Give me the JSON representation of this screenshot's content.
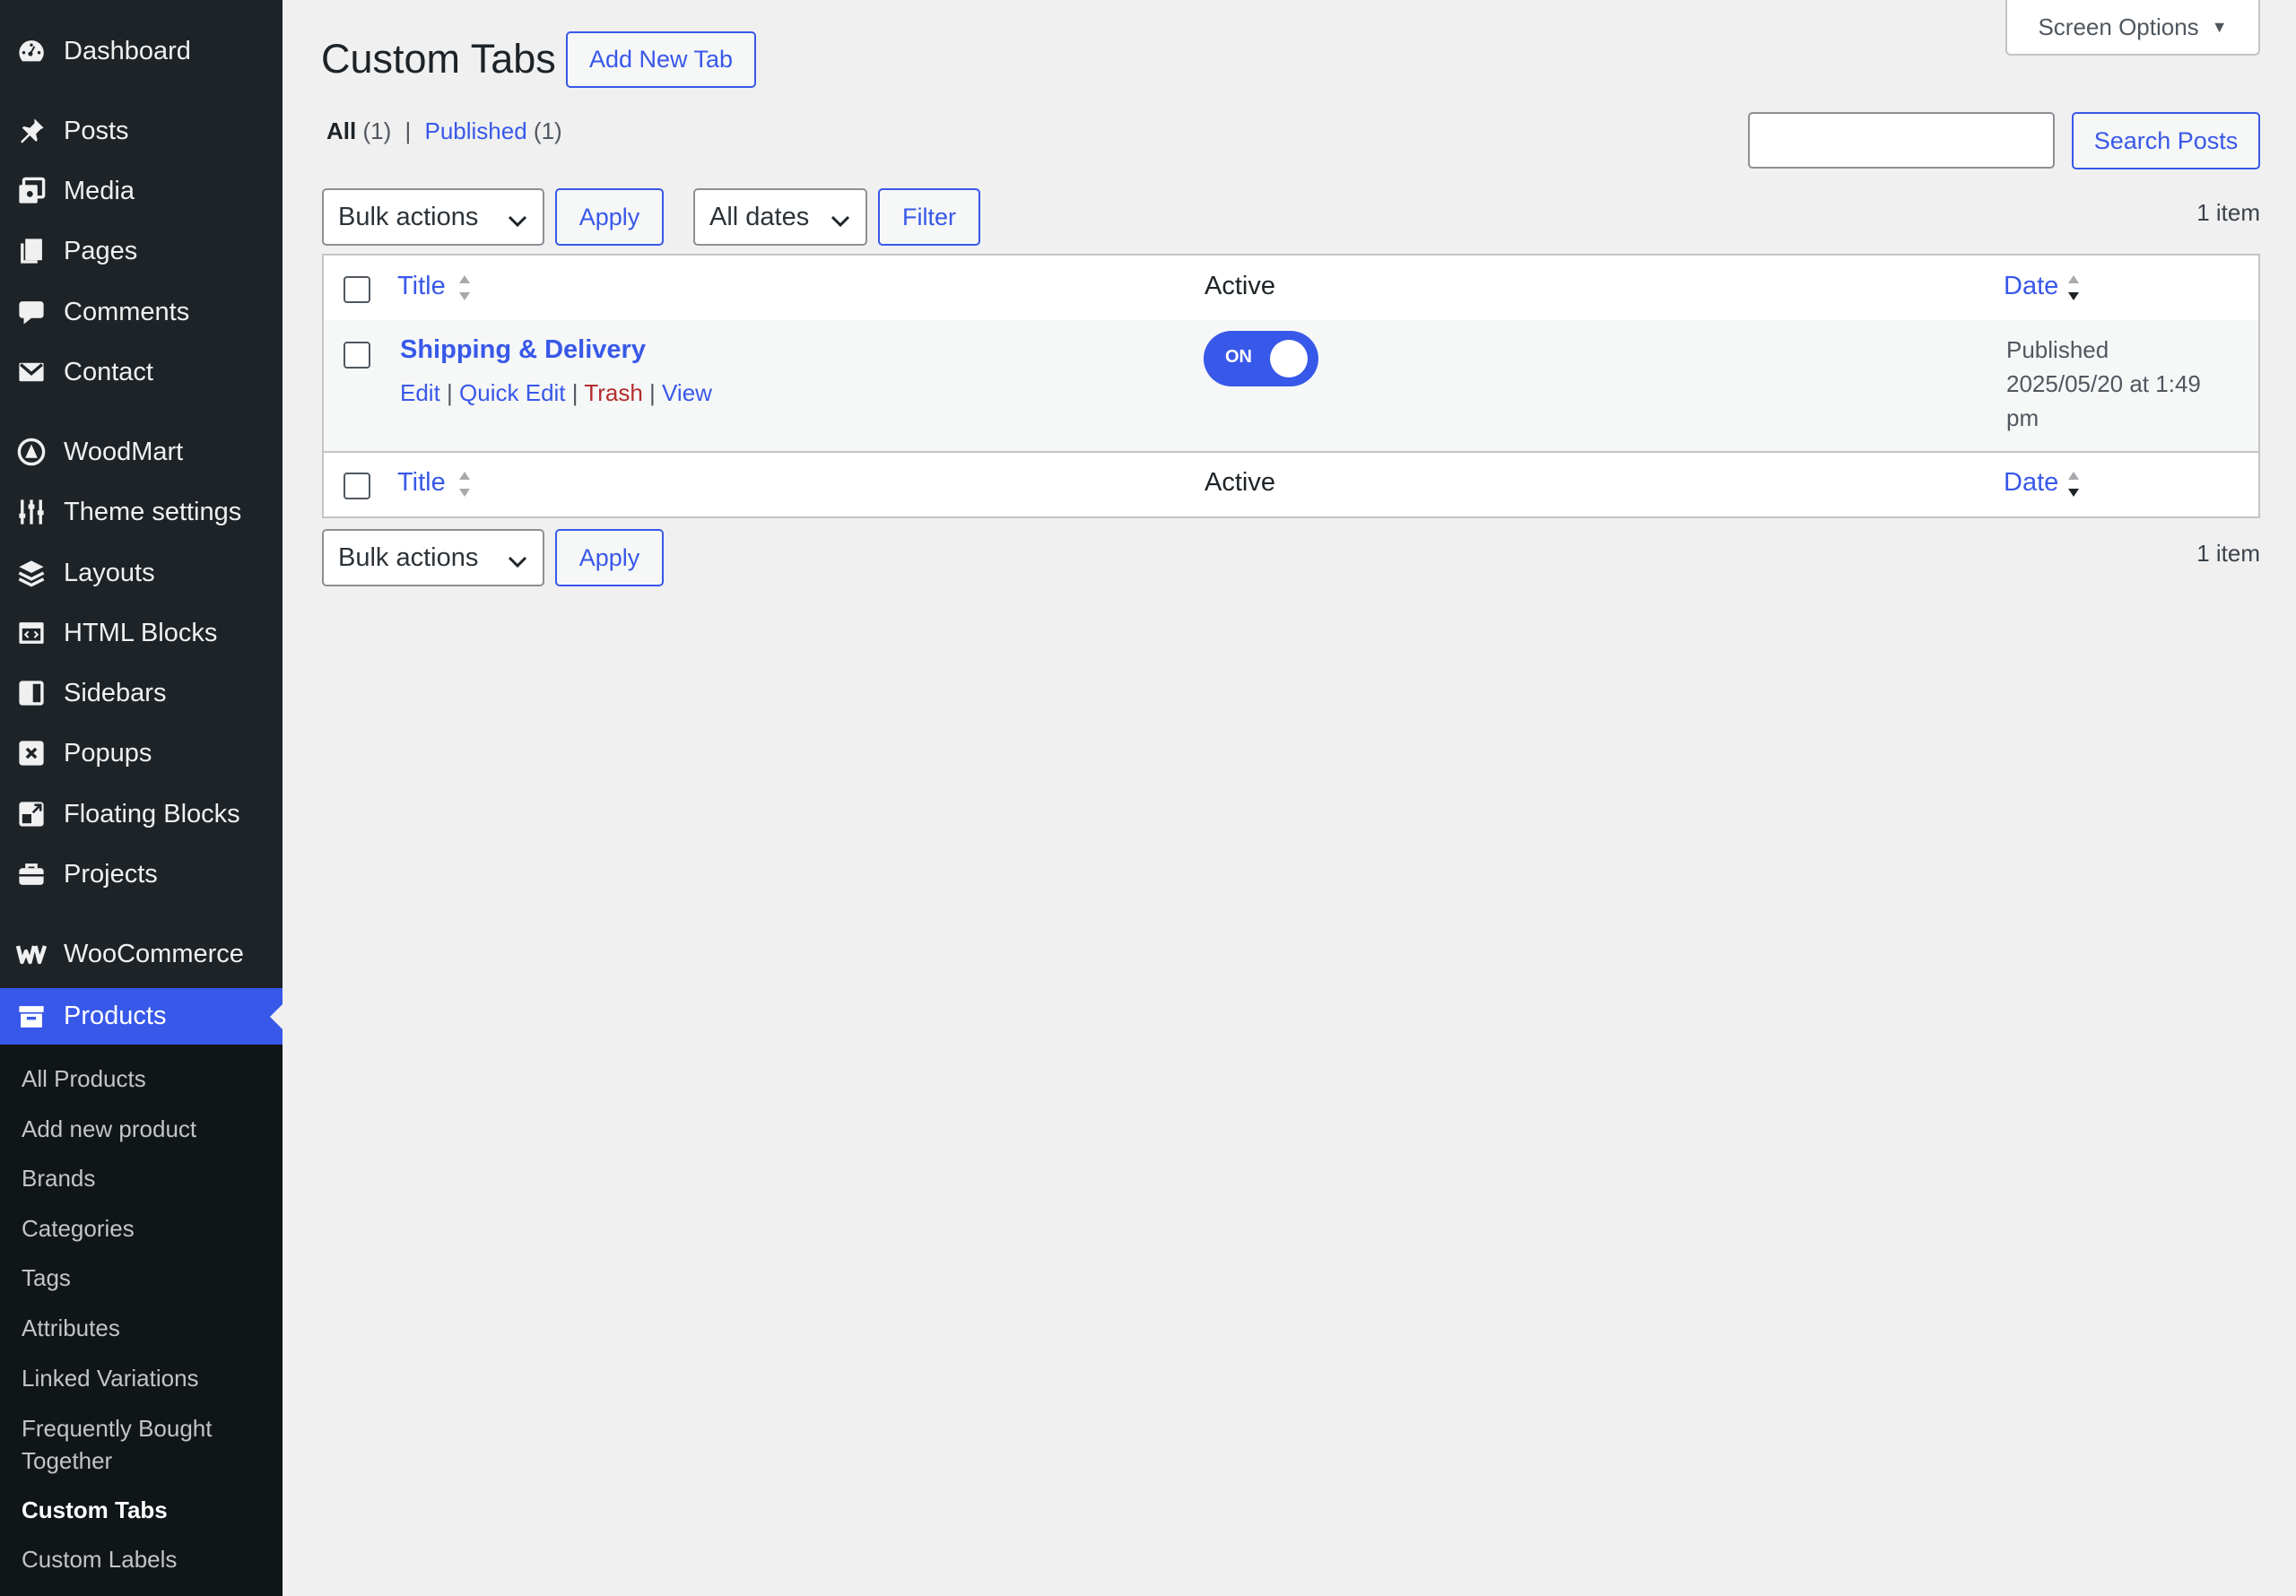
{
  "sidebar": {
    "items": [
      {
        "label": "Dashboard",
        "icon": "dashboard-icon"
      },
      {
        "label": "Posts",
        "icon": "pin-icon"
      },
      {
        "label": "Media",
        "icon": "media-icon"
      },
      {
        "label": "Pages",
        "icon": "pages-icon"
      },
      {
        "label": "Comments",
        "icon": "comment-icon"
      },
      {
        "label": "Contact",
        "icon": "mail-icon"
      },
      {
        "label": "WoodMart",
        "icon": "woodmart-icon"
      },
      {
        "label": "Theme settings",
        "icon": "sliders-icon"
      },
      {
        "label": "Layouts",
        "icon": "layers-icon"
      },
      {
        "label": "HTML Blocks",
        "icon": "code-icon"
      },
      {
        "label": "Sidebars",
        "icon": "sidebar-icon"
      },
      {
        "label": "Popups",
        "icon": "popup-icon"
      },
      {
        "label": "Floating Blocks",
        "icon": "floating-icon"
      },
      {
        "label": "Projects",
        "icon": "briefcase-icon"
      },
      {
        "label": "WooCommerce",
        "icon": "woo-icon"
      },
      {
        "label": "Products",
        "icon": "archive-icon"
      }
    ],
    "submenu": [
      "All Products",
      "Add new product",
      "Brands",
      "Categories",
      "Tags",
      "Attributes",
      "Linked Variations",
      "Frequently Bought Together",
      "Custom Tabs",
      "Custom Labels"
    ]
  },
  "header": {
    "title": "Custom Tabs",
    "add_button": "Add New Tab",
    "screen_options": "Screen Options"
  },
  "views": {
    "all_label": "All",
    "all_count": "(1)",
    "separator": "|",
    "published_label": "Published",
    "published_count": "(1)"
  },
  "search": {
    "value": "",
    "button": "Search Posts"
  },
  "top_nav": {
    "bulk_actions": "Bulk actions",
    "apply": "Apply",
    "dates": "All dates",
    "filter": "Filter",
    "count": "1 item"
  },
  "table": {
    "columns": {
      "title": "Title",
      "active": "Active",
      "date": "Date"
    },
    "rows": [
      {
        "title": "Shipping & Delivery",
        "actions": {
          "edit": "Edit",
          "quick_edit": "Quick Edit",
          "trash": "Trash",
          "view": "View",
          "sep": "|"
        },
        "active": "ON",
        "active_state": true,
        "date_status": "Published",
        "date_line1": "2025/05/20 at 1:49",
        "date_line2": "pm"
      }
    ]
  },
  "bottom_nav": {
    "bulk_actions": "Bulk actions",
    "apply": "Apply",
    "count": "1 item"
  },
  "colors": {
    "sidebar_bg": "#1d2327",
    "submenu_bg": "#101517",
    "accent": "#3858e9",
    "trash": "#b32d2e"
  }
}
